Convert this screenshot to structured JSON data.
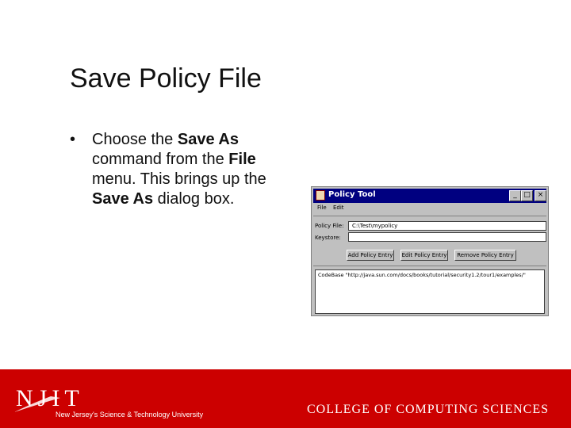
{
  "slide": {
    "title": "Save Policy File",
    "bullet_symbol": "•",
    "bullet_parts": [
      "Choose the ",
      "Save As",
      " command from the ",
      "File",
      " menu. This brings up the ",
      "Save As",
      " dialog box."
    ]
  },
  "window": {
    "title": "Policy Tool",
    "controls": [
      "_",
      "□",
      "×"
    ],
    "menu": [
      "File",
      "Edit"
    ],
    "policy_file_label": "Policy File:",
    "policy_file_value": "C:\\Test\\mypolicy",
    "keystore_label": "Keystore:",
    "keystore_value": "",
    "buttons": [
      "Add Policy Entry",
      "Edit Policy Entry",
      "Remove Policy Entry"
    ],
    "entries": [
      "CodeBase \"http://java.sun.com/docs/books/tutorial/security1.2/tour1/examples/\""
    ]
  },
  "footer": {
    "logo_text": "NJIT",
    "tagline": "New Jersey's Science & Technology University",
    "college": "COLLEGE OF COMPUTING SCIENCES",
    "color": "#cc0000"
  }
}
